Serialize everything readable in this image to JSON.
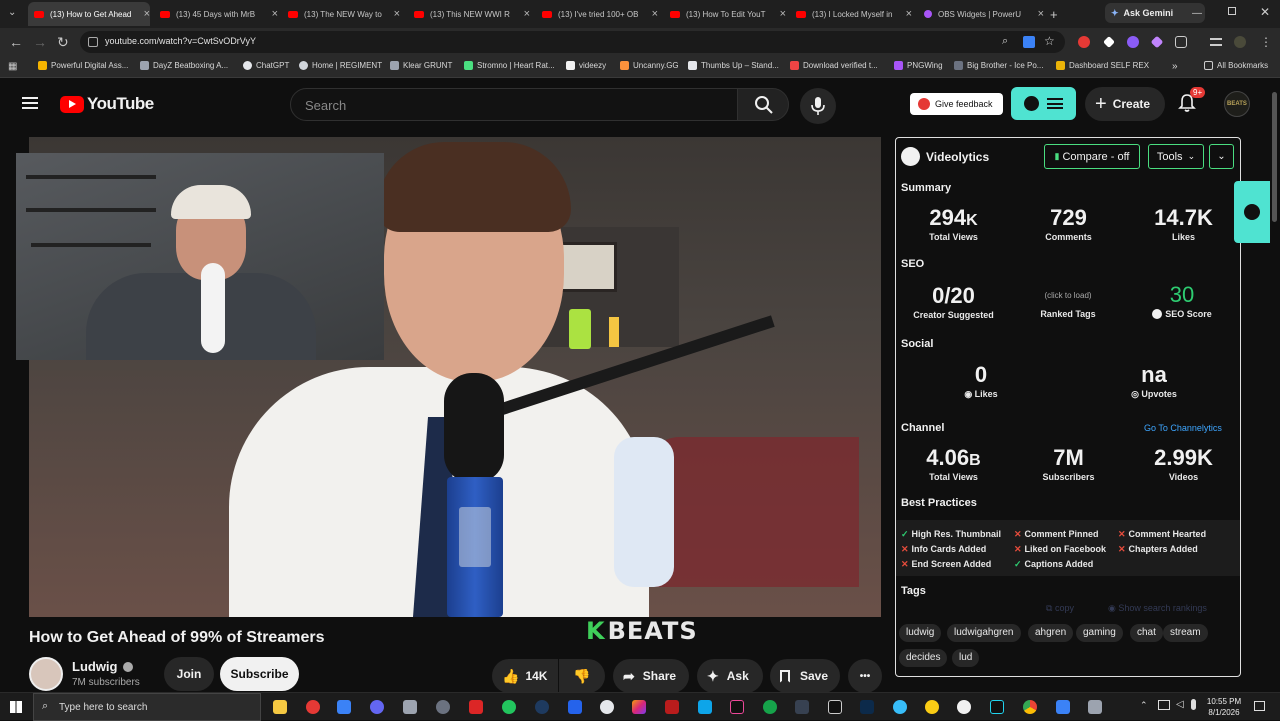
{
  "browser": {
    "tabs": [
      {
        "title": "(13) How to Get Ahead",
        "active": true
      },
      {
        "title": "(13) 45 Days with MrB",
        "active": false
      },
      {
        "title": "(13) The NEW Way to",
        "active": false
      },
      {
        "title": "(13) This NEW WWI R",
        "active": false
      },
      {
        "title": "(13) I've tried 100+ OB",
        "active": false
      },
      {
        "title": "(13) How To Edit YouT",
        "active": false
      },
      {
        "title": "(13) I Locked Myself in",
        "active": false
      },
      {
        "title": "OBS Widgets | PowerU",
        "active": false
      }
    ],
    "ask_gemini": "Ask Gemini",
    "new_tab": "+",
    "close_x": "×",
    "url": "youtube.com/watch?v=CwtSvODrVyY",
    "bookmarks": [
      "Powerful Digital Ass...",
      "DayZ Beatboxing A...",
      "ChatGPT",
      "Home | REGIMENT",
      "Klear GRUNT",
      "Stromno | Heart Rat...",
      "videezy",
      "Uncanny.GG",
      "Thumbs Up – Stand...",
      "Download verified t...",
      "PNGWing",
      "Big Brother - Ice Po...",
      "Dashboard SELF REX"
    ],
    "bookmarks_overflow": "»",
    "all_bookmarks": "All Bookmarks"
  },
  "youtube": {
    "logo_text": "YouTube",
    "search_placeholder": "Search",
    "give_feedback": "Give feedback",
    "create": "Create",
    "notif_badge": "9+",
    "avatar_text": "BEATS"
  },
  "video": {
    "title": "How to Get Ahead of 99% of Streamers",
    "watermark": "BEATS",
    "watermark_k": "K",
    "channel_name": "Ludwig",
    "subscribers": "7M subscribers",
    "join": "Join",
    "subscribe": "Subscribe",
    "likes": "14K",
    "share": "Share",
    "ask": "Ask",
    "save": "Save",
    "more": "•••"
  },
  "videolytics": {
    "brand": "Videolytics",
    "compare": "Compare - off",
    "tools": "Tools",
    "summary_label": "Summary",
    "summary": [
      {
        "value": "294",
        "suffix": "K",
        "label": "Total Views"
      },
      {
        "value": "729",
        "suffix": "",
        "label": "Comments"
      },
      {
        "value": "14.7K",
        "suffix": "",
        "label": "Likes"
      }
    ],
    "seo_label": "SEO",
    "seo_creator": {
      "value": "0/20",
      "label": "Creator Suggested"
    },
    "seo_tags": {
      "value": "(click to load)",
      "label": "Ranked Tags"
    },
    "seo_score": {
      "value": "30",
      "label": "SEO Score"
    },
    "social_label": "Social",
    "social_likes": {
      "value": "0",
      "label": "Likes"
    },
    "social_upvotes": {
      "value": "na",
      "label": "Upvotes"
    },
    "channel_label": "Channel",
    "channel_link": "Go To Channelytics",
    "channel": [
      {
        "value": "4.06",
        "suffix": "B",
        "label": "Total Views"
      },
      {
        "value": "7M",
        "suffix": "",
        "label": "Subscribers"
      },
      {
        "value": "2.99K",
        "suffix": "",
        "label": "Videos"
      }
    ],
    "best_practices_label": "Best Practices",
    "best_practices": [
      {
        "label": "High Res. Thumbnail",
        "ok": true
      },
      {
        "label": "Comment Pinned",
        "ok": false
      },
      {
        "label": "Comment Hearted",
        "ok": false
      },
      {
        "label": "Info Cards Added",
        "ok": false
      },
      {
        "label": "Liked on Facebook",
        "ok": false
      },
      {
        "label": "Chapters Added",
        "ok": false
      },
      {
        "label": "End Screen Added",
        "ok": false
      },
      {
        "label": "Captions Added",
        "ok": true
      }
    ],
    "tags_label": "Tags",
    "tags_copy": "copy",
    "tags_rankings": "Show search rankings",
    "tags": [
      "ludwig",
      "ludwigahgren",
      "ahgren",
      "gaming",
      "chat",
      "stream",
      "decides",
      "lud"
    ]
  },
  "taskbar": {
    "search_placeholder": "Type here to search",
    "time": "10:55 PM",
    "date": "8/1/2026"
  },
  "colors": {
    "accent_cyan": "#4fe3d1",
    "yt_red": "#ff0000",
    "seo_green": "#2ecc71",
    "link_blue": "#3ea6ff"
  }
}
